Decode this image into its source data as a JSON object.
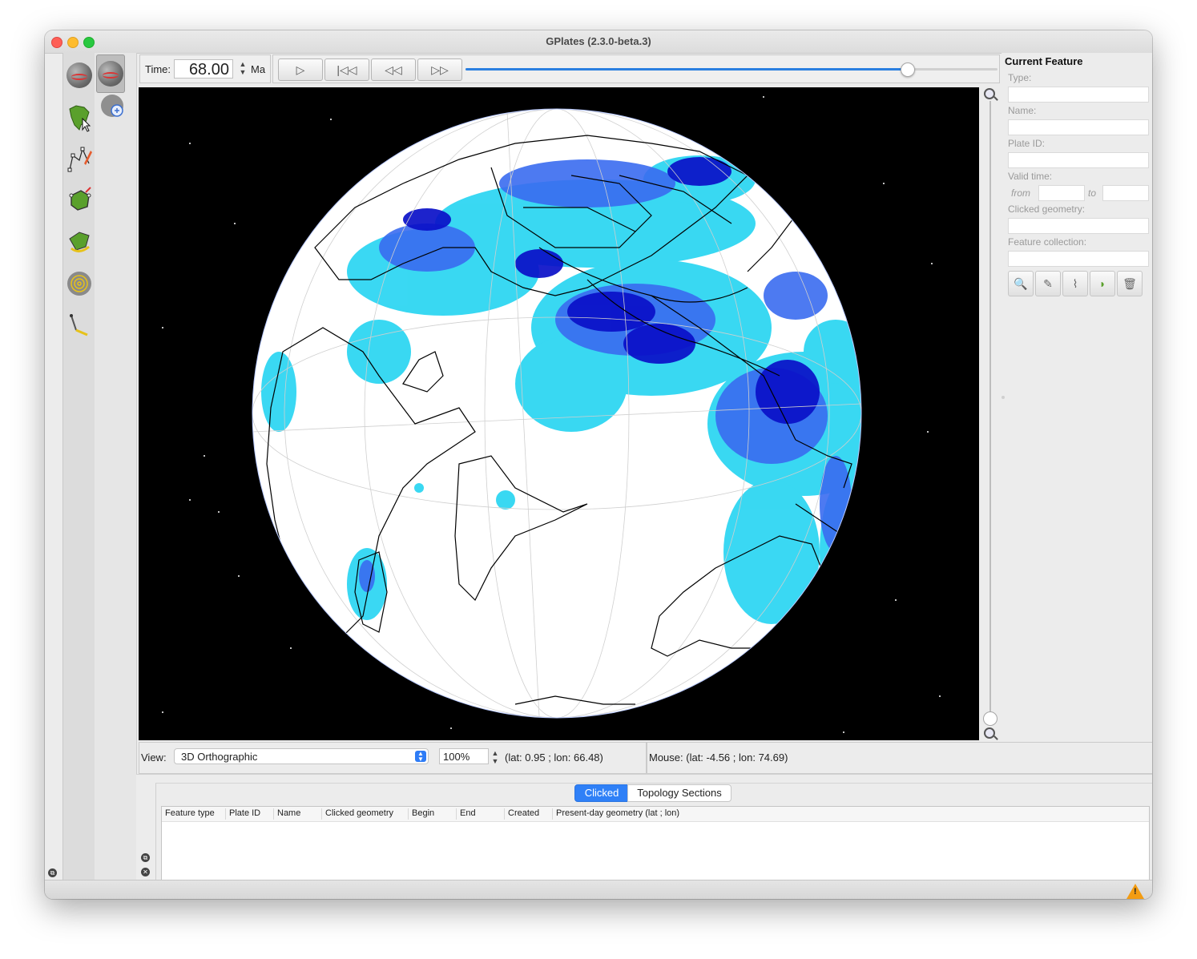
{
  "window": {
    "title": "GPlates (2.3.0-beta.3)"
  },
  "tools": {
    "column1": [
      {
        "name": "drag-globe-icon"
      },
      {
        "name": "choose-feature-icon"
      },
      {
        "name": "digitise-geometry-icon"
      },
      {
        "name": "build-topology-icon"
      },
      {
        "name": "modify-pole-icon"
      },
      {
        "name": "small-circle-icon"
      },
      {
        "name": "measure-distance-icon"
      }
    ],
    "column2": [
      {
        "name": "rotate-globe-icon"
      },
      {
        "name": "zoom-globe-icon"
      }
    ]
  },
  "timebar": {
    "time_label": "Time:",
    "time_value": "68.00",
    "units": "Ma",
    "buttons": [
      "play",
      "reset",
      "step-back",
      "step-forward"
    ],
    "slider_fraction": 0.83,
    "accent": "#2b7fe0"
  },
  "current_feature": {
    "title": "Current Feature",
    "type_label": "Type:",
    "name_label": "Name:",
    "plate_id_label": "Plate ID:",
    "valid_time_label": "Valid time:",
    "from_label": "from",
    "to_label": "to",
    "clicked_geometry_label": "Clicked geometry:",
    "feature_collection_label": "Feature collection:",
    "actions": [
      "query-feature-icon",
      "edit-feature-icon",
      "clone-geometry-icon",
      "reconstruct-icon",
      "delete-feature-icon"
    ]
  },
  "view": {
    "label": "View:",
    "projection": "3D Orthographic",
    "zoom": "100%",
    "center": "(lat: 0.95 ; lon: 66.48)"
  },
  "mouse": {
    "text": "Mouse: (lat: -4.56 ; lon: 74.69)"
  },
  "bottom": {
    "tabs": [
      {
        "label": "Clicked",
        "active": true
      },
      {
        "label": "Topology Sections",
        "active": false
      }
    ],
    "columns": [
      "Feature type",
      "Plate ID",
      "Name",
      "Clicked geometry",
      "Begin",
      "End",
      "Created",
      "Present-day geometry (lat ; lon)"
    ]
  }
}
